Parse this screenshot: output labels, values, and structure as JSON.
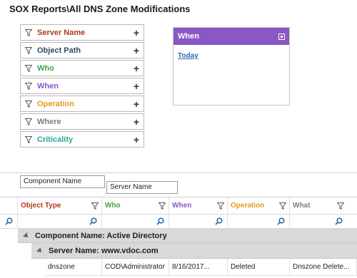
{
  "page": {
    "title": "SOX Reports\\All DNS Zone Modifications"
  },
  "filters": [
    {
      "label": "Server Name",
      "color": "#b3391f"
    },
    {
      "label": "Object Path",
      "color": "#2d4a5e"
    },
    {
      "label": "Who",
      "color": "#3aa34a"
    },
    {
      "label": "When",
      "color": "#8a57c4"
    },
    {
      "label": "Operation",
      "color": "#e59a1e"
    },
    {
      "label": "Where",
      "color": "#7d7d7d"
    },
    {
      "label": "Criticality",
      "color": "#2aa596"
    }
  ],
  "when_panel": {
    "title": "When",
    "link": "Today",
    "header_color": "#8a57c4"
  },
  "grouping": {
    "chip1": "Component Name",
    "chip2": "Server Name"
  },
  "grid": {
    "columns": [
      {
        "label": "Object Type",
        "color": "#b3391f"
      },
      {
        "label": "Who",
        "color": "#3aa34a"
      },
      {
        "label": "When",
        "color": "#8a57c4"
      },
      {
        "label": "Operation",
        "color": "#e59a1e"
      },
      {
        "label": "What",
        "color": "#7d7d7d"
      }
    ],
    "group1": "Component Name: Active Directory",
    "group2": "Server Name: www.vdoc.com",
    "rows": [
      {
        "object_type": "dnszone",
        "who": "COD\\Administrator",
        "when": "8/16/2017...",
        "operation": "Deleted",
        "what": "Dnszone Delete..."
      }
    ]
  }
}
